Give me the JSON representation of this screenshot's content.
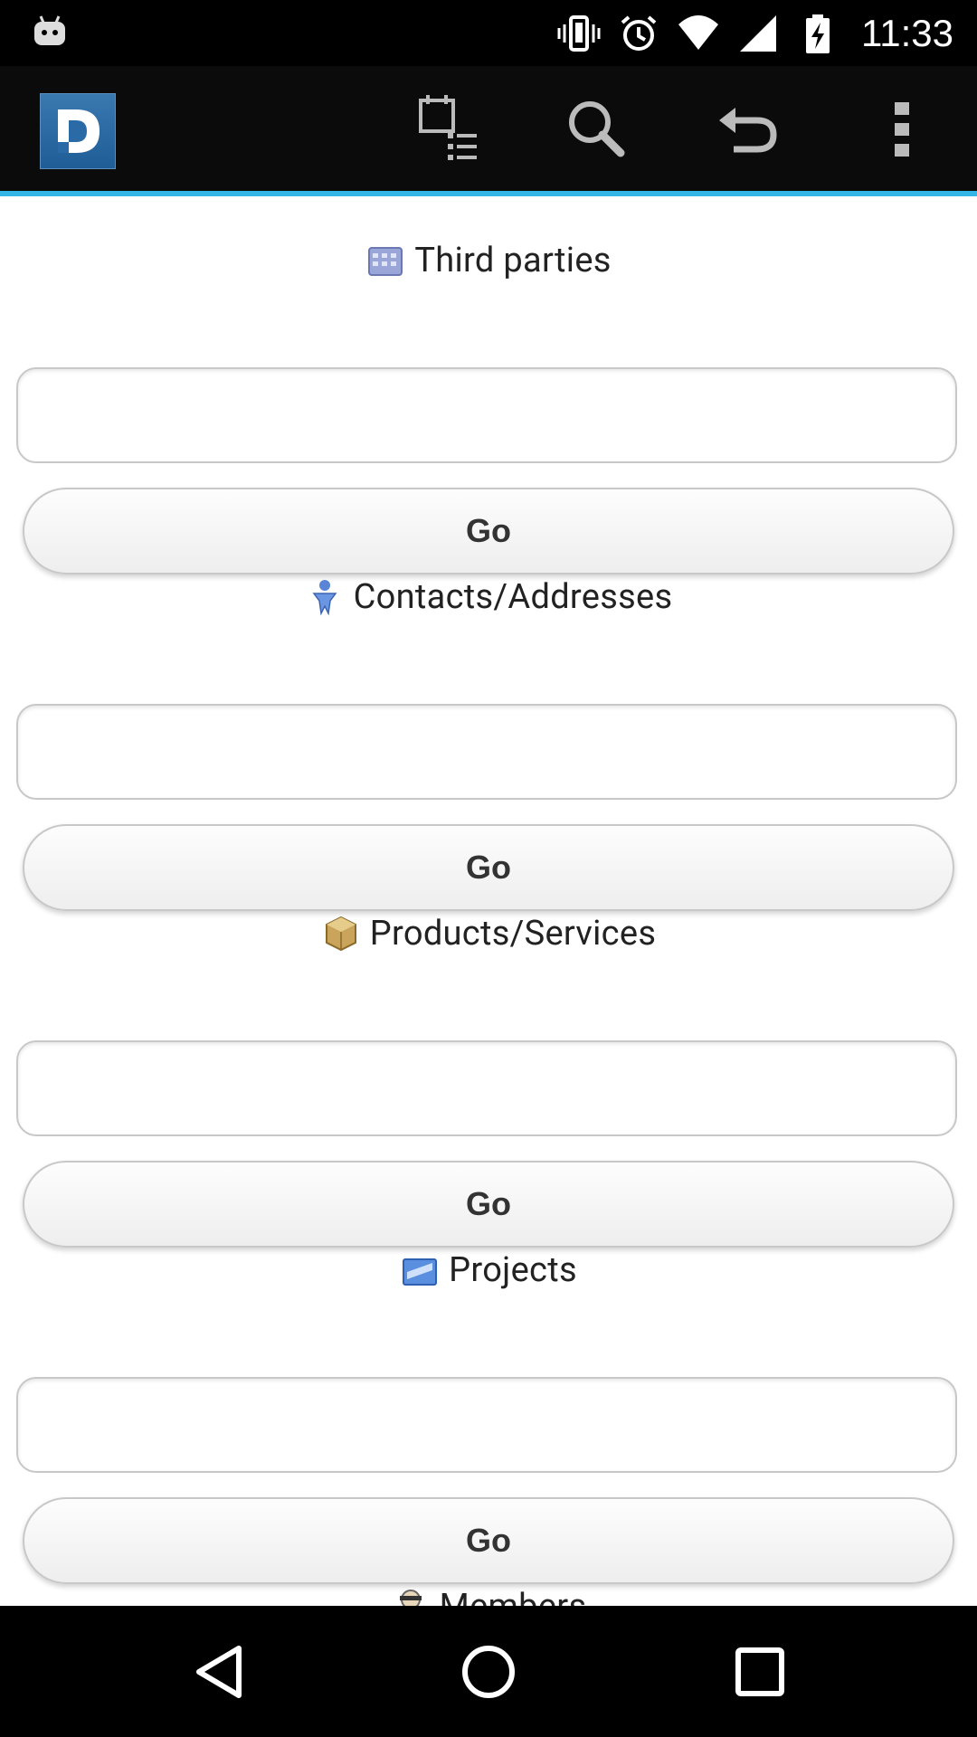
{
  "status_bar": {
    "time": "11:33",
    "icons": [
      "android-debug-icon",
      "vibrate-icon",
      "alarm-icon",
      "wifi-icon",
      "signal-icon",
      "battery-charging-icon"
    ]
  },
  "action_bar": {
    "logo_letter": "D",
    "actions": [
      "agenda-list-icon",
      "search-icon",
      "undo-icon",
      "overflow-menu-icon"
    ]
  },
  "sections": [
    {
      "title": "Third parties",
      "icon": "third-parties-icon",
      "input_value": "",
      "button_label": "Go"
    },
    {
      "title": "Contacts/Addresses",
      "icon": "contact-person-icon",
      "input_value": "",
      "button_label": "Go"
    },
    {
      "title": "Products/Services",
      "icon": "product-box-icon",
      "input_value": "",
      "button_label": "Go"
    },
    {
      "title": "Projects",
      "icon": "project-folder-icon",
      "input_value": "",
      "button_label": "Go"
    },
    {
      "title": "Members",
      "icon": "member-icon"
    }
  ],
  "nav_bar": {
    "buttons": [
      "back-icon",
      "home-icon",
      "recents-icon"
    ]
  },
  "colors": {
    "accent_line": "#33b5e5",
    "action_bar_bg": "#0b0b0b",
    "logo_bg": "#2a6aa6"
  }
}
